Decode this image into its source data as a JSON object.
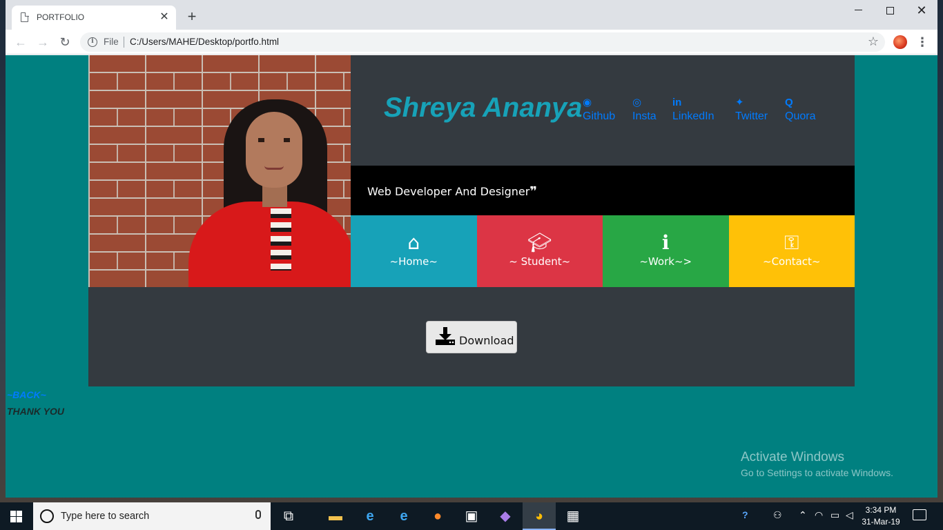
{
  "browser": {
    "tab_title": "PORTFOLIO",
    "tab_close": "✕",
    "new_tab": "+",
    "scheme": "File",
    "url": "C:/Users/MAHE/Desktop/portfo.html"
  },
  "page": {
    "name": "Shreya Ananya",
    "social": [
      {
        "label": "Github",
        "icon": "github-icon"
      },
      {
        "label": "Insta",
        "icon": "instagram-icon"
      },
      {
        "label": "LinkedIn",
        "icon": "linkedin-icon"
      },
      {
        "label": "Twitter",
        "icon": "twitter-icon"
      },
      {
        "label": "Quora",
        "icon": "quora-icon"
      }
    ],
    "tagline": "Web Developer And Designer",
    "tiles": [
      {
        "label": "~Home~",
        "icon": "home-icon",
        "color": "#17a2b8"
      },
      {
        "label": "~ Student~",
        "icon": "graduation-cap-icon",
        "color": "#dc3545"
      },
      {
        "label": "~Work~>",
        "icon": "info-icon",
        "color": "#28a745"
      },
      {
        "label": "~Contact~",
        "icon": "key-icon",
        "color": "#ffc107"
      }
    ],
    "download_label": "Download",
    "back_link": "~BACK~",
    "thank_you": "THANK YOU",
    "colors": {
      "background": "#008080",
      "card": "#343a40",
      "name": "#17a2b8",
      "link": "#007bff"
    }
  },
  "watermark": {
    "title": "Activate Windows",
    "subtitle": "Go to Settings to activate Windows."
  },
  "taskbar": {
    "search_placeholder": "Type here to search",
    "time": "3:34 PM",
    "date": "31-Mar-19"
  }
}
